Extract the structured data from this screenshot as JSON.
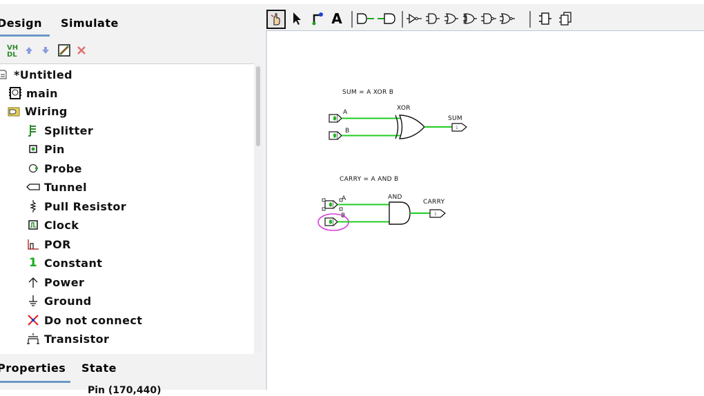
{
  "left_panel": {
    "tabs": [
      {
        "label": "Design"
      },
      {
        "label": "Simulate"
      }
    ],
    "toolbar": [
      {
        "icon": "vhdl-icon",
        "label": "VH\nDL"
      },
      {
        "icon": "arrow-up-icon"
      },
      {
        "icon": "arrow-down-icon"
      },
      {
        "icon": "edit-icon"
      },
      {
        "icon": "delete-icon"
      }
    ],
    "tree": [
      {
        "label": "*Untitled",
        "icon": "project-icon"
      },
      {
        "label": "main",
        "icon": "circuit-icon"
      },
      {
        "label": "Wiring",
        "icon": "folder-icon"
      },
      {
        "label": "Splitter",
        "icon": "splitter-icon"
      },
      {
        "label": "Pin",
        "icon": "pin-icon"
      },
      {
        "label": "Probe",
        "icon": "probe-icon"
      },
      {
        "label": "Tunnel",
        "icon": "tunnel-icon"
      },
      {
        "label": "Pull Resistor",
        "icon": "resistor-icon"
      },
      {
        "label": "Clock",
        "icon": "clock-icon"
      },
      {
        "label": "POR",
        "icon": "por-icon"
      },
      {
        "label": "Constant",
        "icon": "constant-icon",
        "glyph": "1"
      },
      {
        "label": "Power",
        "icon": "power-icon"
      },
      {
        "label": "Ground",
        "icon": "ground-icon"
      },
      {
        "label": "Do not connect",
        "icon": "no-connect-icon"
      },
      {
        "label": "Transistor",
        "icon": "transistor-icon"
      }
    ],
    "bottom_tabs": [
      {
        "label": "Properties"
      },
      {
        "label": "State"
      }
    ],
    "selection_info": "Pin (170,440)"
  },
  "main_toolbar": {
    "tools": [
      {
        "icon": "hand-poke-icon"
      },
      {
        "icon": "select-arrow-icon"
      },
      {
        "icon": "wire-icon"
      },
      {
        "icon": "text-tool-icon",
        "label": "A"
      },
      {
        "icon": "input-pin-icon"
      },
      {
        "icon": "output-pin-icon"
      },
      {
        "icon": "not-gate-icon"
      },
      {
        "icon": "buffer-gate-icon"
      },
      {
        "icon": "and-gate-icon"
      },
      {
        "icon": "or-gate-icon"
      },
      {
        "icon": "nand-gate-icon"
      },
      {
        "icon": "nor-gate-icon"
      },
      {
        "icon": "xor-gate-icon"
      },
      {
        "icon": "subcircuit-icon"
      },
      {
        "icon": "multi-circuit-icon"
      }
    ]
  },
  "canvas": {
    "sum_caption": "SUM = A XOR B",
    "carry_caption": "CARRY = A AND B",
    "xor_label": "XOR",
    "and_label": "AND",
    "sum_label": "SUM",
    "carry_label": "CARRY",
    "input_a": "A",
    "input_b": "B",
    "pin_value": "0",
    "output_value": "1",
    "wire_color": "#22cc22",
    "selection_color": "#d63fd6"
  }
}
